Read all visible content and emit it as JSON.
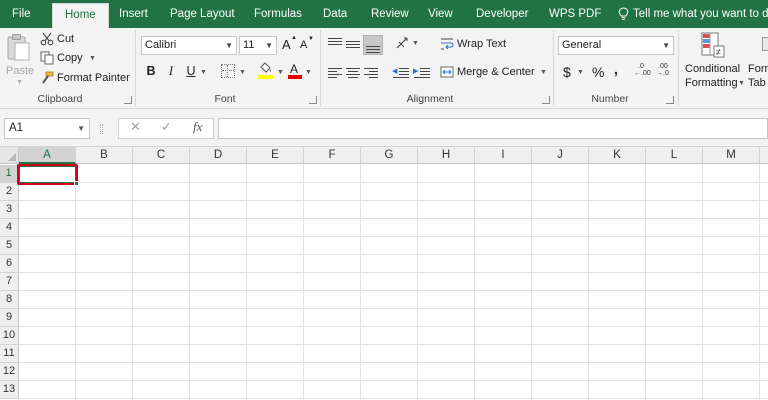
{
  "tabs": [
    {
      "label": "File"
    },
    {
      "label": "Home",
      "active": true
    },
    {
      "label": "Insert"
    },
    {
      "label": "Page Layout"
    },
    {
      "label": "Formulas"
    },
    {
      "label": "Data"
    },
    {
      "label": "Review"
    },
    {
      "label": "View"
    },
    {
      "label": "Developer"
    },
    {
      "label": "WPS PDF"
    }
  ],
  "tell_me": "Tell me what you want to do...",
  "clipboard": {
    "paste_label": "Paste",
    "cut_label": "Cut",
    "copy_label": "Copy",
    "format_painter_label": "Format Painter",
    "group_label": "Clipboard"
  },
  "font": {
    "family_value": "Calibri",
    "size_value": "11",
    "grow_label": "A",
    "shrink_label": "A",
    "bold_label": "B",
    "italic_label": "I",
    "underline_label": "U",
    "font_color_label": "A",
    "highlight_color": "#ffff00",
    "font_color": "#e00000",
    "group_label": "Font"
  },
  "alignment": {
    "wrap_text_label": "Wrap Text",
    "merge_center_label": "Merge & Center",
    "group_label": "Alignment"
  },
  "number": {
    "format_value": "General",
    "currency_label": "$",
    "percent_label": "%",
    "comma_label": ",",
    "group_label": "Number"
  },
  "styles": {
    "conditional_line1": "Conditional",
    "conditional_line2": "Formatting",
    "format_table_line1": "Form",
    "format_table_line2": "Tab"
  },
  "formula_bar": {
    "name_box_value": "A1",
    "cancel_label": "✕",
    "enter_label": "✓",
    "fx_label": "fx",
    "formula_value": ""
  },
  "grid": {
    "columns": [
      "A",
      "B",
      "C",
      "D",
      "E",
      "F",
      "G",
      "H",
      "I",
      "J",
      "K",
      "L",
      "M"
    ],
    "rows": [
      "1",
      "2",
      "3",
      "4",
      "5",
      "6",
      "7",
      "8",
      "9",
      "10",
      "11",
      "12",
      "13"
    ],
    "selected_cell": "A1"
  },
  "colors": {
    "accent": "#217346",
    "selection_highlight": "#d0021b"
  }
}
